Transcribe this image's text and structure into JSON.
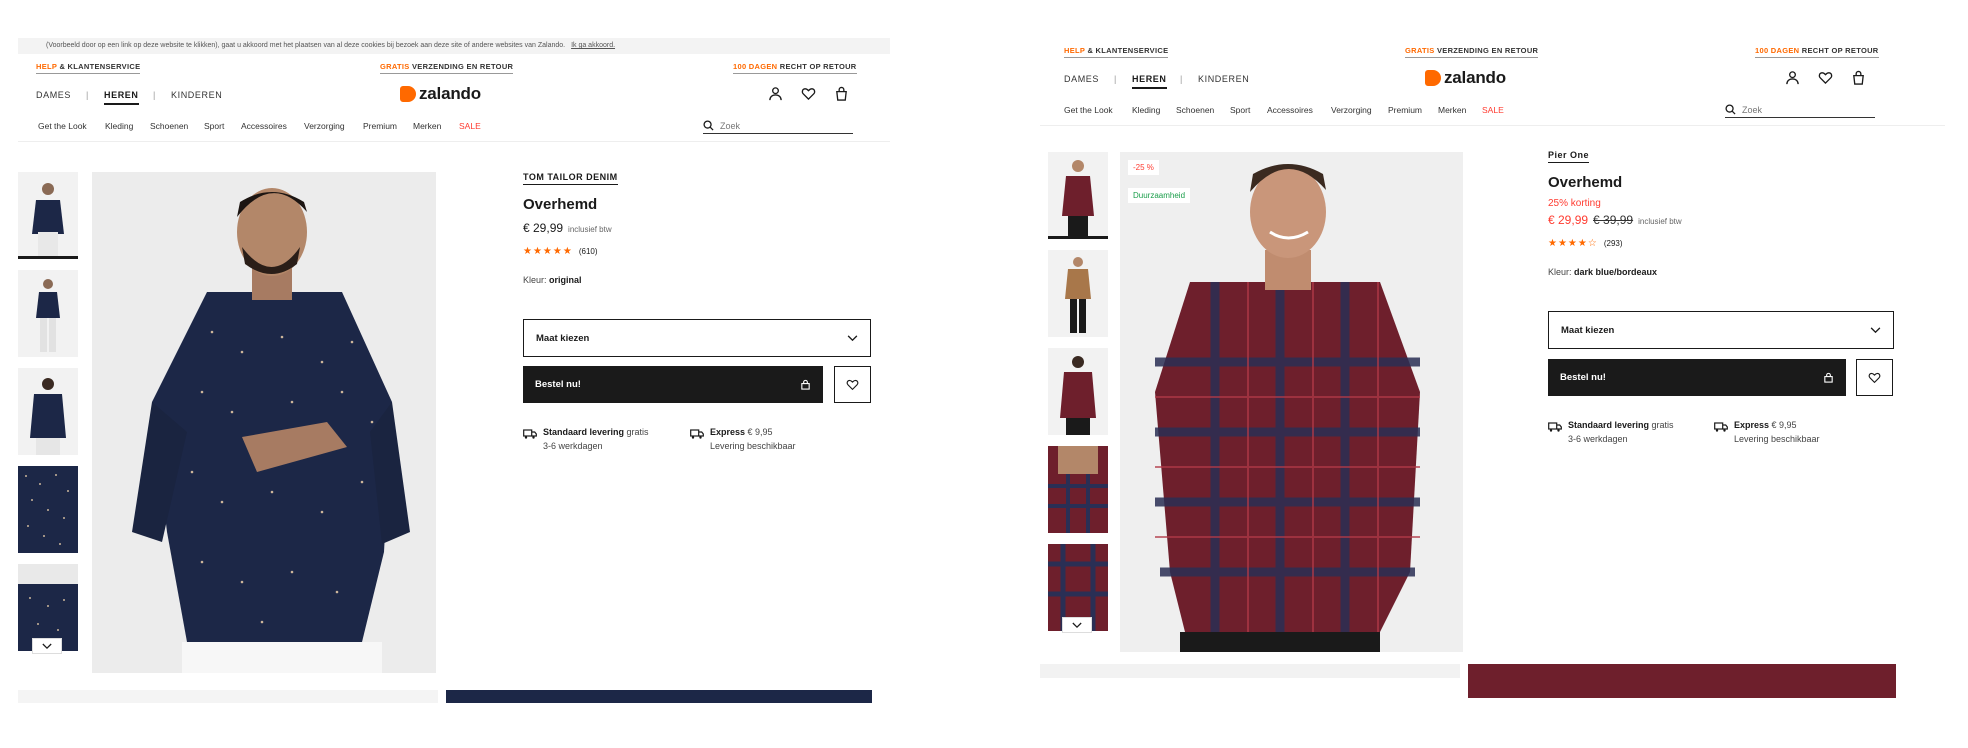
{
  "left": {
    "cookie_text": "(Voorbeeld door op een link op deze website te klikken), gaat u akkoord met het plaatsen van al deze cookies bij bezoek aan deze site of andere websites van Zalando.",
    "cookie_link": "Ik ga akkoord.",
    "topbar": {
      "help_accent": "HELP",
      "help_rest": " & KLANTENSERVICE",
      "shipping_accent": "GRATIS",
      "shipping_rest": " VERZENDING EN RETOUR",
      "return_accent": "100 DAGEN",
      "return_rest": " RECHT OP RETOUR"
    },
    "gender": {
      "women": "DAMES",
      "men": "HEREN",
      "kids": "KINDEREN"
    },
    "logo_text": "zalando",
    "categories": [
      "Get the Look",
      "Kleding",
      "Schoenen",
      "Sport",
      "Accessoires",
      "Verzorging",
      "Premium",
      "Merken",
      "SALE"
    ],
    "search_placeholder": "Zoek",
    "product": {
      "brand": "TOM TAILOR DENIM",
      "name": "Overhemd",
      "price": "€ 29,99",
      "vat": "inclusief btw",
      "rating_count": "(610)",
      "color_label": "Kleur:",
      "color_value": "original",
      "size_label": "Maat kiezen",
      "order_label": "Bestel nu!"
    },
    "shipping": {
      "standard_title": "Standaard levering",
      "standard_free": " gratis",
      "standard_time": "3-6 werkdagen",
      "express_title": "Express",
      "express_price": " € 9,95",
      "express_note": "Levering beschikbaar"
    }
  },
  "right": {
    "topbar": {
      "help_accent": "HELP",
      "help_rest": " & KLANTENSERVICE",
      "shipping_accent": "GRATIS",
      "shipping_rest": " VERZENDING EN RETOUR",
      "return_accent": "100 DAGEN",
      "return_rest": " RECHT OP RETOUR"
    },
    "gender": {
      "women": "DAMES",
      "men": "HEREN",
      "kids": "KINDEREN"
    },
    "logo_text": "zalando",
    "categories": [
      "Get the Look",
      "Kleding",
      "Schoenen",
      "Sport",
      "Accessoires",
      "Verzorging",
      "Premium",
      "Merken",
      "SALE"
    ],
    "search_placeholder": "Zoek",
    "badges": {
      "discount": "-25 %",
      "sustainability": "Duurzaamheid"
    },
    "product": {
      "brand": "Pier One",
      "name": "Overhemd",
      "discount_text": "25% korting",
      "price": "€ 29,99",
      "old_price": "€ 39,99",
      "vat": "inclusief btw",
      "rating_count": "(293)",
      "color_label": "Kleur:",
      "color_value": "dark blue/bordeaux",
      "size_label": "Maat kiezen",
      "order_label": "Bestel nu!"
    },
    "shipping": {
      "standard_title": "Standaard levering",
      "standard_free": " gratis",
      "standard_time": "3-6 werkdagen",
      "express_title": "Express",
      "express_price": " € 9,95",
      "express_note": "Levering beschikbaar"
    }
  },
  "colors": {
    "accent": "#ff6900",
    "sale_red": "#ff3b30",
    "eco_green": "#1a9e4a",
    "dark": "#1a1a1a",
    "shirt_navy": "#1c2747",
    "shirt_bordeaux": "#6e1f2c"
  }
}
